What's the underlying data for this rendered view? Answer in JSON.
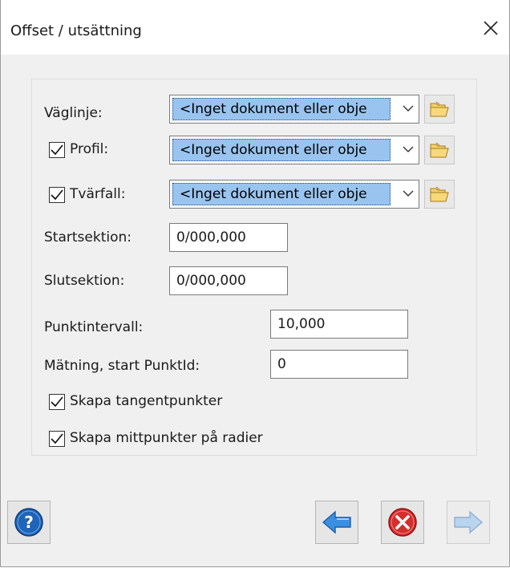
{
  "window": {
    "title": "Offset / utsättning",
    "close_icon": "close-x"
  },
  "form": {
    "vaglinje": {
      "label": "Väglinje:",
      "value": "<Inget dokument eller objе",
      "browse_icon": "open-folder"
    },
    "profil": {
      "label": "Profil:",
      "checked": true,
      "value": "<Inget dokument eller objе",
      "browse_icon": "open-folder"
    },
    "tvarfall": {
      "label": "Tvärfall:",
      "checked": true,
      "value": "<Inget dokument eller objе",
      "browse_icon": "open-folder"
    },
    "startsektion": {
      "label": "Startsektion:",
      "value": "0/000,000"
    },
    "slutsektion": {
      "label": "Slutsektion:",
      "value": "0/000,000"
    },
    "punktintervall": {
      "label": "Punktintervall:",
      "value": "10,000"
    },
    "matning": {
      "label": "Mätning, start PunktId:",
      "value": "0"
    },
    "tangentpunkter": {
      "label": "Skapa tangentpunkter",
      "checked": true
    },
    "mittpunkter": {
      "label": "Skapa mittpunkter på radier",
      "checked": true
    }
  },
  "buttons": {
    "help_icon": "help-circle",
    "back_icon": "arrow-left",
    "cancel_icon": "cancel-circle",
    "next_icon": "arrow-right",
    "next_enabled": false
  },
  "colors": {
    "selection": "#99c4ef",
    "help_blue": "#1f64b8",
    "cancel_red": "#d62d2d",
    "arrow_blue": "#3b8fe0"
  }
}
